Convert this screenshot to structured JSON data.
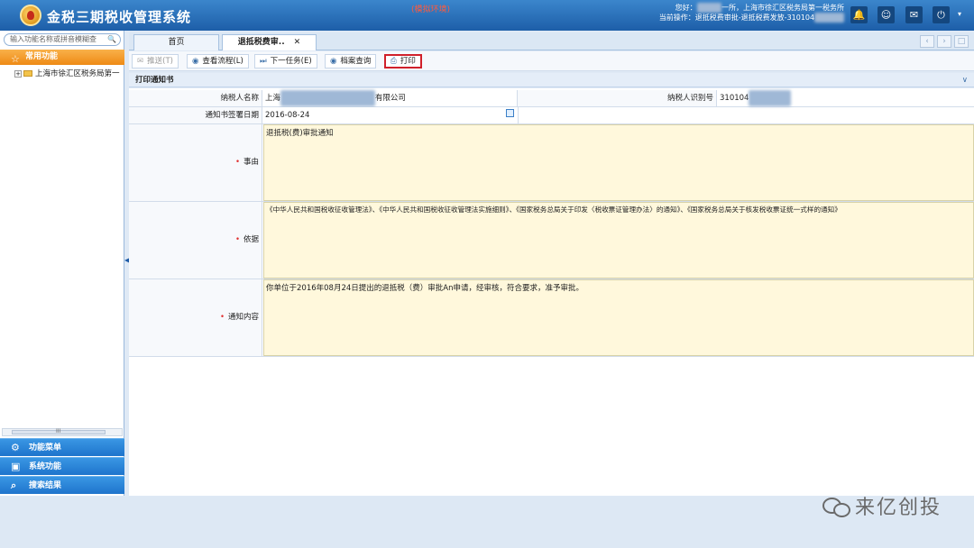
{
  "header": {
    "app_title": "金税三期税收管理系统",
    "env_tag": "(模拟环境)",
    "greeting_prefix": "您好：",
    "greeting_suffix": "一所，上海市徐汇区税务局第一税务所",
    "current_op": "当前操作：退抵税费审批-退抵税费发放-310104"
  },
  "sidebar": {
    "search_placeholder": "输入功能名称或拼音模糊查",
    "favorites_label": "常用功能",
    "tree_item": "上海市徐汇区税务局第一",
    "scroll_mid": "III",
    "nav": [
      "功能菜单",
      "系统功能",
      "搜索结果"
    ]
  },
  "tabs": [
    {
      "label": "首页",
      "active": false
    },
    {
      "label": "退抵税费审..",
      "active": true,
      "close": "✕"
    }
  ],
  "toolbar": {
    "send": "推送(T)",
    "view_flow": "查看流程(L)",
    "next_task": "下一任务(E)",
    "archive": "档案查询",
    "print": "打印"
  },
  "section_title": "打印通知书",
  "form": {
    "taxpayer_name_label": "纳税人名称",
    "taxpayer_name_prefix": "上海",
    "taxpayer_name_suffix": "有限公司",
    "taxpayer_id_label": "纳税人识别号",
    "taxpayer_id_prefix": "310104",
    "sign_date_label": "通知书签署日期",
    "sign_date": "2016-08-24",
    "reason_label": "事由",
    "reason": "退抵税(费)审批通知",
    "basis_label": "依据",
    "basis": "《中华人民共和国税收征收管理法》、《中华人民共和国税收征收管理法实施细则》、《国家税务总局关于印发〈税收票证管理办法〉的通知》、《国家税务总局关于核发税收票证统一式样的通知》",
    "notice_label": "通知内容",
    "notice": "你单位于2016年08月24日提出的退抵税（费）审批An申请，经审核，符合要求，准予审批。"
  },
  "watermark": "来亿创投",
  "colors": {
    "accent": "#1d5ea8",
    "favorites": "#ee8a15",
    "print_highlight": "#d0202a",
    "field_bg": "#fff8dc"
  }
}
